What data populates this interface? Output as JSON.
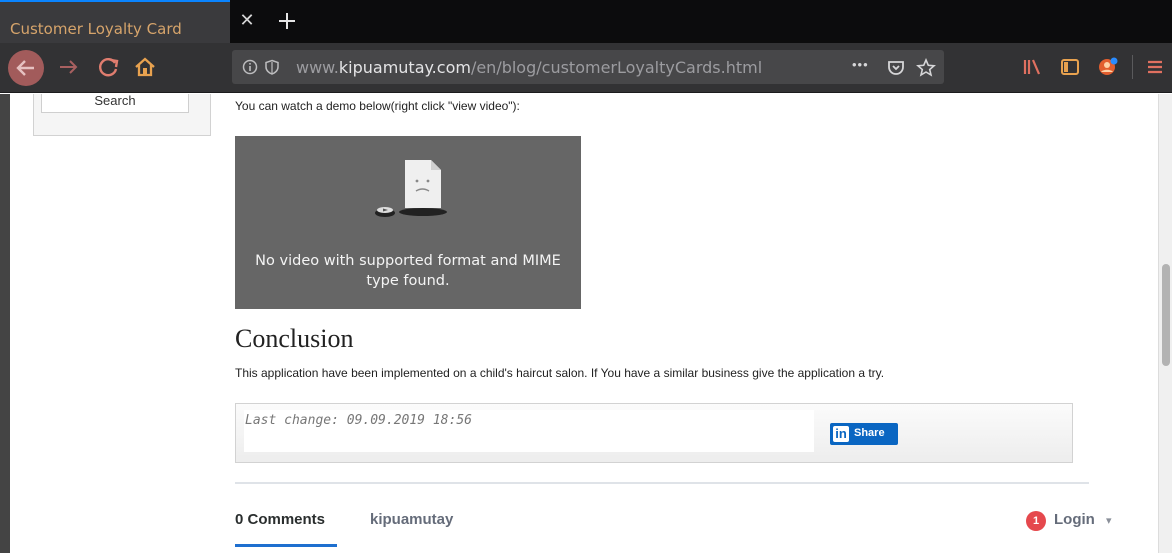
{
  "browser": {
    "tab_title": "Customer Loyalty Card",
    "url_prefix": "www.",
    "url_domain": "kipuamutay.com",
    "url_path": "/en/blog/customerLoyaltyCards.html",
    "more_glyph": "•••"
  },
  "sidebar": {
    "search_label": "Search"
  },
  "content": {
    "intro": "You can watch a demo below(right click \"view video\"):",
    "video_error_line1": "No video with supported format and MIME",
    "video_error_line2": "type found.",
    "conclusion_heading": "Conclusion",
    "conclusion_text": "This application have been implemented on a child's haircut salon. If You have a similar business give the application a try.",
    "last_change": "Last change: 09.09.2019 18:56",
    "share_in": "in",
    "share_label": "Share"
  },
  "comments": {
    "tab_comments": "0 Comments",
    "tab_site": "kipuamutay",
    "badge_count": "1",
    "login_label": "Login",
    "login_caret": "▾"
  }
}
